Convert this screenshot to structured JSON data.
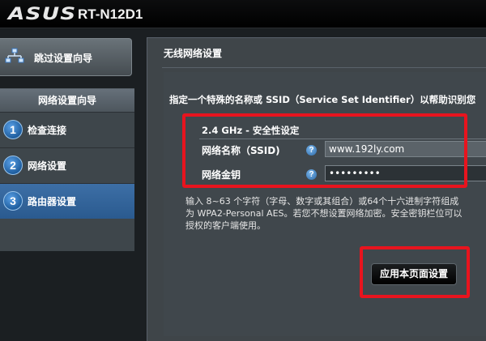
{
  "header": {
    "logo": "ASUS",
    "model": "RT-N12D1"
  },
  "sidebar": {
    "skip_wizard_label": "跳过设置向导",
    "wizard_title": "网络设置向导",
    "steps": [
      {
        "number": "1",
        "label": "检查连接"
      },
      {
        "number": "2",
        "label": "网络设置"
      },
      {
        "number": "3",
        "label": "路由器设置",
        "active": true
      }
    ]
  },
  "main": {
    "title": "无线网络设置",
    "description": "指定一个特殊的名称或 SSID（Service Set Identifier）以帮助识别您",
    "security_title": "2.4 GHz - 安全性设定",
    "ssid": {
      "label": "网络名称（SSID)",
      "value": "www.192ly.com",
      "help_icon": "?"
    },
    "key": {
      "label": "网络金钥",
      "value": "•••••••••",
      "help_icon": "?"
    },
    "hint_lines": [
      "输入 8~63 个字符（字母、数字或其组合）或64个十六进制字符组成",
      "为 WPA2-Personal AES。若您不想设置网络加密。安全密钥栏位可以",
      "授权的客户端使用。"
    ],
    "apply_button": "应用本页面设置"
  },
  "colors": {
    "accent_blue": "#2a5a8f",
    "annotation_red": "#e8141e",
    "panel_bg": "#3f4549"
  }
}
